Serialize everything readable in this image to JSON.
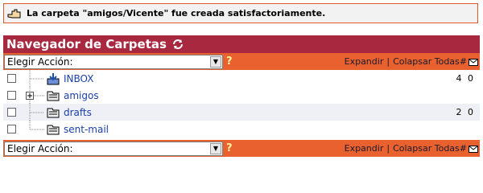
{
  "notice": {
    "message": "La carpeta \"amigos/Vicente\" fue creada satisfactoriamente."
  },
  "header": {
    "title": "Navegador de Carpetas"
  },
  "action_bar": {
    "select_value": "Elegir Acción:",
    "help": "?",
    "expand_label": "Expandir",
    "separator": "|",
    "collapse_label": "Colapsar Todas",
    "hash": "#"
  },
  "folders": [
    {
      "name": "INBOX",
      "count": "4 0",
      "icon": "inbox-icon"
    },
    {
      "name": "amigos",
      "count": "",
      "icon": "folder-icon"
    },
    {
      "name": "drafts",
      "count": "2 0",
      "icon": "folder-icon"
    },
    {
      "name": "sent-mail",
      "count": "",
      "icon": "folder-icon"
    }
  ],
  "colors": {
    "header_bg": "#a8283f",
    "action_bg": "#e8612e",
    "link": "#1a3fa8",
    "notice_border": "#e05a28"
  }
}
